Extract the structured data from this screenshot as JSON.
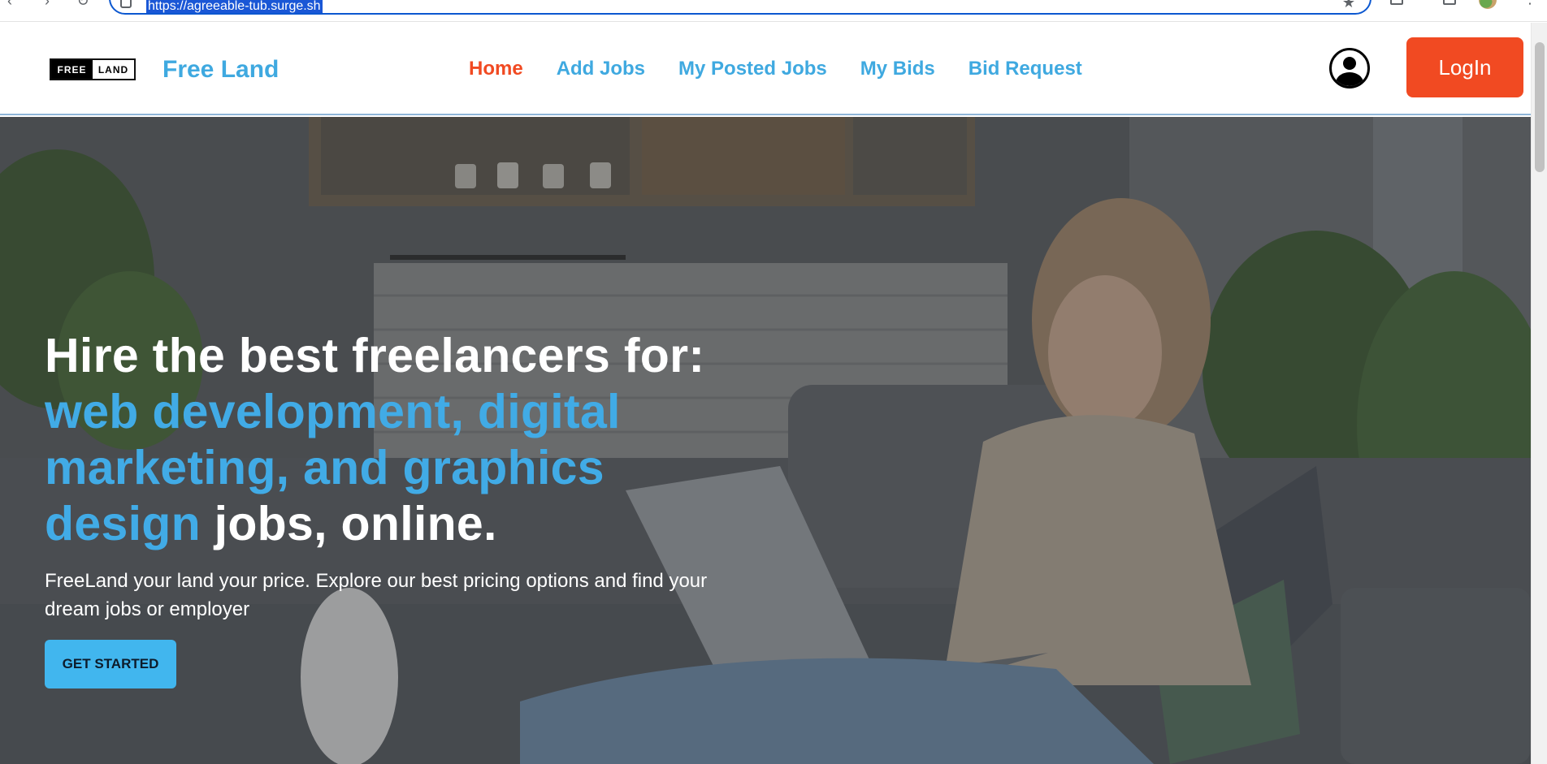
{
  "browser": {
    "url": "https://agreeable-tub.surge.sh",
    "icons": [
      "back-icon",
      "forward-icon",
      "reload-icon",
      "site-info-icon",
      "star-icon",
      "extensions-icon",
      "profile-icon",
      "menu-icon"
    ]
  },
  "header": {
    "logo": {
      "left": "FREE",
      "right": "LAND"
    },
    "brand": "Free Land",
    "nav": [
      {
        "label": "Home",
        "active": true
      },
      {
        "label": "Add Jobs",
        "active": false
      },
      {
        "label": "My Posted Jobs",
        "active": false
      },
      {
        "label": "My Bids",
        "active": false
      },
      {
        "label": "Bid Request",
        "active": false
      }
    ],
    "user_icon": "user-avatar-icon",
    "login_label": "LogIn"
  },
  "hero": {
    "title_line1": "Hire the best freelancers for:",
    "title_accent": "web development, digital marketing, and graphics design",
    "title_end": "jobs, online.",
    "subtitle": "FreeLand your land your price. Explore our best pricing options and find your dream jobs or employer",
    "cta_label": "GET STARTED"
  },
  "colors": {
    "accent_blue": "#3fa9e0",
    "brand_orange": "#f14a22",
    "cta_blue": "#41b6ee"
  }
}
